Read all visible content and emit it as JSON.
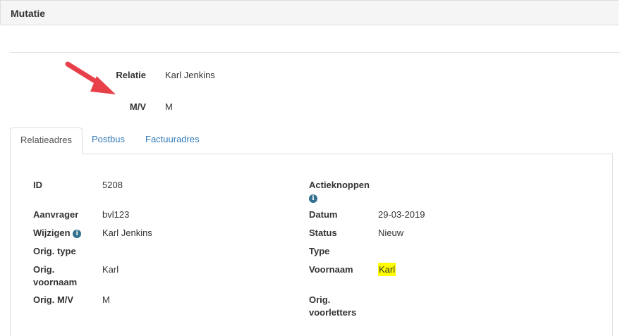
{
  "header": {
    "title": "Mutatie"
  },
  "colors": {
    "arrow": "#e8404a",
    "highlight": "#ffff00",
    "link": "#337ab7",
    "info": "#31708f"
  },
  "top_fields": [
    {
      "label": "Relatie",
      "value": "Karl Jenkins"
    },
    {
      "label": "M/V",
      "value": "M"
    }
  ],
  "tabs": [
    {
      "label": "Relatieadres",
      "active": true
    },
    {
      "label": "Postbus",
      "active": false
    },
    {
      "label": "Factuuradres",
      "active": false
    }
  ],
  "left": {
    "id": {
      "label": "ID",
      "value": "5208"
    },
    "aanvrager": {
      "label": "Aanvrager",
      "value": "bvl123"
    },
    "wijzigen": {
      "label": "Wijzigen",
      "value": "Karl Jenkins",
      "icon": "info-icon"
    },
    "orig_type": {
      "label": "Orig. type",
      "value": ""
    },
    "orig_voornaam": {
      "label_line1": "Orig.",
      "label_line2": "voornaam",
      "value": "Karl"
    },
    "orig_mv": {
      "label": "Orig. M/V",
      "value": "M"
    }
  },
  "right": {
    "actieknoppen": {
      "label": "Actieknoppen",
      "icon": "info-icon"
    },
    "datum": {
      "label": "Datum",
      "value": "29-03-2019"
    },
    "status": {
      "label": "Status",
      "value": "Nieuw"
    },
    "type": {
      "label": "Type",
      "value": ""
    },
    "voornaam": {
      "label": "Voornaam",
      "value": "Karl"
    },
    "orig_voorletters": {
      "label_line1": "Orig.",
      "label_line2": "voorletters"
    }
  }
}
